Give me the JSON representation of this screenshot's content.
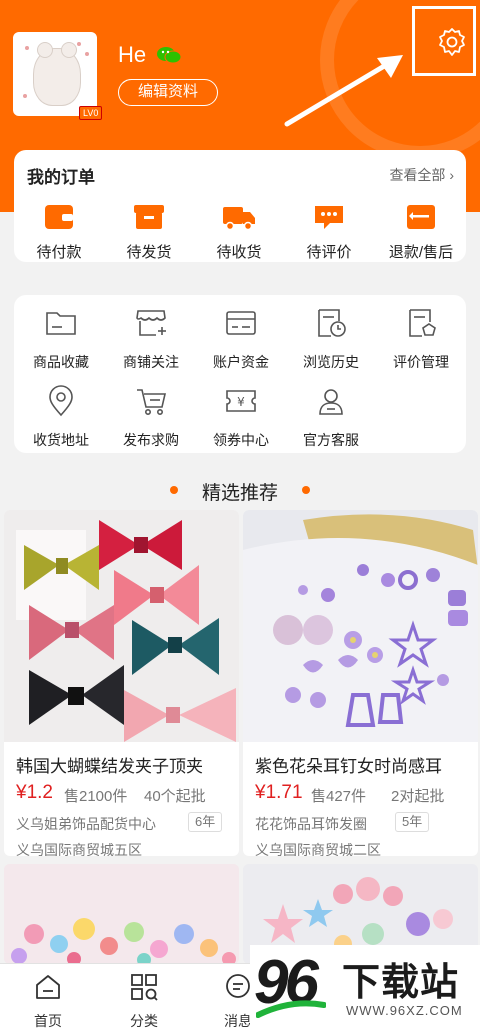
{
  "profile": {
    "username": "He",
    "edit_label": "编辑资料",
    "level": "LV0"
  },
  "orders": {
    "title": "我的订单",
    "view_all": "查看全部",
    "items": [
      {
        "label": "待付款",
        "icon": "wallet-icon"
      },
      {
        "label": "待发货",
        "icon": "box-icon"
      },
      {
        "label": "待收货",
        "icon": "truck-icon"
      },
      {
        "label": "待评价",
        "icon": "comment-icon"
      },
      {
        "label": "退款/售后",
        "icon": "refund-icon"
      }
    ]
  },
  "tools": {
    "items": [
      {
        "label": "商品收藏",
        "icon": "folder-icon"
      },
      {
        "label": "商铺关注",
        "icon": "shop-icon"
      },
      {
        "label": "账户资金",
        "icon": "card-icon"
      },
      {
        "label": "浏览历史",
        "icon": "history-icon"
      },
      {
        "label": "评价管理",
        "icon": "review-icon"
      },
      {
        "label": "收货地址",
        "icon": "location-icon"
      },
      {
        "label": "发布求购",
        "icon": "cart-icon"
      },
      {
        "label": "领券中心",
        "icon": "coupon-icon"
      },
      {
        "label": "官方客服",
        "icon": "service-icon"
      }
    ]
  },
  "recommend": {
    "title": "精选推荐",
    "products": [
      {
        "name": "韩国大蝴蝶结发夹子顶夹",
        "price": "¥1.2",
        "sold": "售2100件",
        "min": "40个起批",
        "store": "义乌姐弟饰品配货中心",
        "years": "6年",
        "location": "义乌国际商贸城五区"
      },
      {
        "name": "紫色花朵耳钉女时尚感耳",
        "price": "¥1.71",
        "sold": "售427件",
        "min": "2对起批",
        "store": "花花饰品耳饰发圈",
        "years": "5年",
        "location": "义乌国际商贸城二区"
      }
    ]
  },
  "tabbar": {
    "items": [
      {
        "label": "首页",
        "icon": "home-icon"
      },
      {
        "label": "分类",
        "icon": "category-icon"
      },
      {
        "label": "消息",
        "icon": "message-icon"
      }
    ]
  },
  "watermark": {
    "number": "96",
    "text": "下载站",
    "url": "WWW.96XZ.COM"
  },
  "colors": {
    "accent": "#ff6a00",
    "price": "#e02020"
  }
}
